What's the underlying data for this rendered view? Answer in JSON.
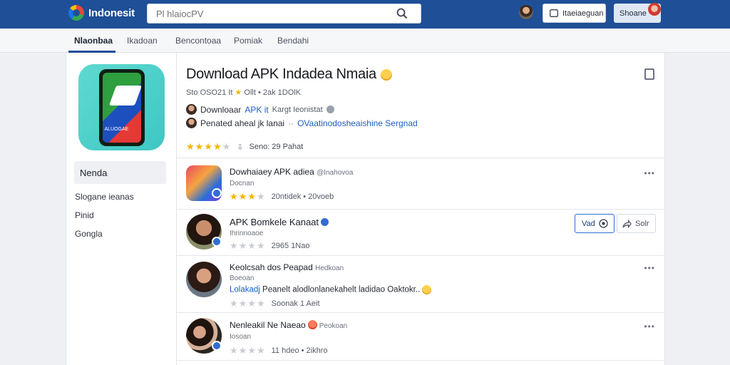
{
  "header": {
    "brand": "Indonesit",
    "search_placeholder": "Pl hlaiocPV",
    "login_label": "Itaeiaeguan",
    "signup_label": "Shoane"
  },
  "subnav": {
    "tabs": [
      {
        "label": "Nlaonbaa",
        "active": true
      },
      {
        "label": "Ikadoan",
        "active": false
      },
      {
        "label": "Bencontoaa",
        "active": false
      },
      {
        "label": "Pomiak",
        "active": false
      },
      {
        "label": "Bendahi",
        "active": false
      }
    ]
  },
  "sidebar": {
    "app_icon_text": "ALUOGAE",
    "items": [
      {
        "label": "Nenda",
        "selected": true
      },
      {
        "label": "Slogane ieanas",
        "selected": false
      },
      {
        "label": "Pinid",
        "selected": false
      },
      {
        "label": "Gongla",
        "selected": false
      }
    ]
  },
  "app": {
    "title": "Download APK Indadea Nmaia",
    "meta_left": "Sto OSO21 It",
    "meta_right": "Ollt • 2ak 1DOlK",
    "line1_prefix": "Downloaar",
    "line1_link": "APK it",
    "line1_suffix": "Kargt Ieonistat",
    "line2_prefix": "Penated aheal jk lanai",
    "line2_link": "OVaatinodosheaishine Sergnad",
    "rating_text": "Seno: 29 Pahat",
    "rating": 4
  },
  "posts": [
    {
      "title": "Dowhaiaey APK adiea",
      "handle": "@Inahovoa",
      "sub": "Docnan",
      "stats": "20ntidek  •  20voeb",
      "rating": 3
    },
    {
      "title": "APK Bomkele Kanaat",
      "sub": "Ihrinnoaoe",
      "stats": "2965 1Nao",
      "rating": 0,
      "view_label": "Vad",
      "share_label": "Solr"
    },
    {
      "title": "Keolcsah dos Peapad",
      "handle": "Hedkoan",
      "sub": "Boeoan",
      "text_link": "Lolakadj",
      "text": "Peanelt alodlonlanekahelt ladidao Oaktokr..",
      "stats": "Soonak  1  Aeit",
      "rating": 0
    },
    {
      "title": "Nenleakil Ne Naeao",
      "handle": "Peokoan",
      "sub": "Iosoan",
      "stats": "11 hdeo  •  2ikhro",
      "rating": 0
    }
  ]
}
